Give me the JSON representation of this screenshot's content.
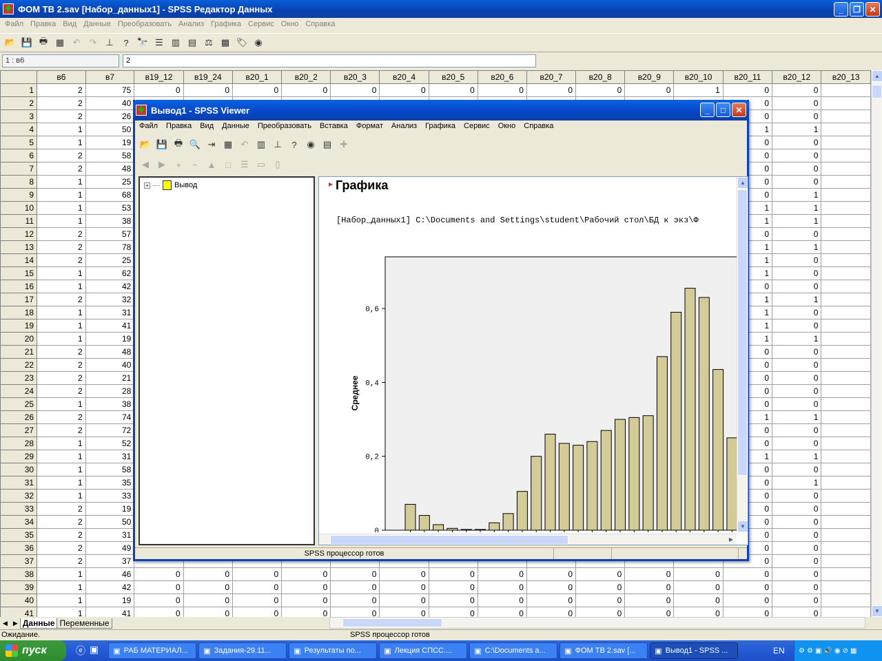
{
  "main_window": {
    "title": "ФОМ ТВ 2.sav [Набор_данных1] - SPSS Редактор Данных",
    "menu": [
      "Файл",
      "Правка",
      "Вид",
      "Данные",
      "Преобразовать",
      "Анализ",
      "Графика",
      "Сервис",
      "Окно",
      "Справка"
    ]
  },
  "cell_editor": {
    "ref": "1 : в6",
    "value": "2"
  },
  "grid": {
    "columns": [
      "в6",
      "в7",
      "в19_12",
      "в19_24",
      "в20_1",
      "в20_2",
      "в20_3",
      "в20_4",
      "в20_5",
      "в20_6",
      "в20_7",
      "в20_8",
      "в20_9",
      "в20_10",
      "в20_11",
      "в20_12",
      "в20_13"
    ],
    "rows": [
      {
        "n": "1",
        "v6": "2",
        "v7": "75",
        "r": [
          "0",
          "0",
          "0",
          "0",
          "0",
          "0",
          "0",
          "0",
          "0",
          "0",
          "0",
          "1",
          "0",
          "0"
        ]
      },
      {
        "n": "2",
        "v6": "2",
        "v7": "40",
        "r": [
          "0",
          "0",
          "0",
          "0",
          "0",
          "0",
          "0",
          "0",
          "0",
          "0",
          "0",
          "0",
          "0",
          "0"
        ]
      },
      {
        "n": "3",
        "v6": "2",
        "v7": "26",
        "r": [
          "",
          "",
          "",
          "",
          "",
          "",
          "",
          "",
          "",
          "",
          "",
          "",
          "0",
          "0"
        ]
      },
      {
        "n": "4",
        "v6": "1",
        "v7": "50",
        "r": [
          "",
          "",
          "",
          "",
          "",
          "",
          "",
          "",
          "",
          "",
          "",
          "",
          "1",
          "1"
        ]
      },
      {
        "n": "5",
        "v6": "1",
        "v7": "19",
        "r": [
          "",
          "",
          "",
          "",
          "",
          "",
          "",
          "",
          "",
          "",
          "",
          "",
          "0",
          "0"
        ]
      },
      {
        "n": "6",
        "v6": "2",
        "v7": "58",
        "r": [
          "",
          "",
          "",
          "",
          "",
          "",
          "",
          "",
          "",
          "",
          "",
          "",
          "0",
          "0"
        ]
      },
      {
        "n": "7",
        "v6": "2",
        "v7": "48",
        "r": [
          "",
          "",
          "",
          "",
          "",
          "",
          "",
          "",
          "",
          "",
          "",
          "",
          "0",
          "0"
        ]
      },
      {
        "n": "8",
        "v6": "1",
        "v7": "25",
        "r": [
          "",
          "",
          "",
          "",
          "",
          "",
          "",
          "",
          "",
          "",
          "",
          "",
          "0",
          "0"
        ]
      },
      {
        "n": "9",
        "v6": "1",
        "v7": "68",
        "r": [
          "",
          "",
          "",
          "",
          "",
          "",
          "",
          "",
          "",
          "",
          "",
          "",
          "0",
          "1"
        ]
      },
      {
        "n": "10",
        "v6": "1",
        "v7": "53",
        "r": [
          "",
          "",
          "",
          "",
          "",
          "",
          "",
          "",
          "",
          "",
          "",
          "",
          "1",
          "1"
        ]
      },
      {
        "n": "11",
        "v6": "1",
        "v7": "38",
        "r": [
          "",
          "",
          "",
          "",
          "",
          "",
          "",
          "",
          "",
          "",
          "",
          "",
          "1",
          "1"
        ]
      },
      {
        "n": "12",
        "v6": "2",
        "v7": "57",
        "r": [
          "",
          "",
          "",
          "",
          "",
          "",
          "",
          "",
          "",
          "",
          "",
          "",
          "0",
          "0"
        ]
      },
      {
        "n": "13",
        "v6": "2",
        "v7": "78",
        "r": [
          "",
          "",
          "",
          "",
          "",
          "",
          "",
          "",
          "",
          "",
          "",
          "",
          "1",
          "1"
        ]
      },
      {
        "n": "14",
        "v6": "2",
        "v7": "25",
        "r": [
          "",
          "",
          "",
          "",
          "",
          "",
          "",
          "",
          "",
          "",
          "",
          "",
          "1",
          "0"
        ]
      },
      {
        "n": "15",
        "v6": "1",
        "v7": "62",
        "r": [
          "",
          "",
          "",
          "",
          "",
          "",
          "",
          "",
          "",
          "",
          "",
          "",
          "1",
          "0"
        ]
      },
      {
        "n": "16",
        "v6": "1",
        "v7": "42",
        "r": [
          "",
          "",
          "",
          "",
          "",
          "",
          "",
          "",
          "",
          "",
          "",
          "",
          "0",
          "0"
        ]
      },
      {
        "n": "17",
        "v6": "2",
        "v7": "32",
        "r": [
          "",
          "",
          "",
          "",
          "",
          "",
          "",
          "",
          "",
          "",
          "",
          "",
          "1",
          "1"
        ]
      },
      {
        "n": "18",
        "v6": "1",
        "v7": "31",
        "r": [
          "",
          "",
          "",
          "",
          "",
          "",
          "",
          "",
          "",
          "",
          "",
          "",
          "1",
          "0"
        ]
      },
      {
        "n": "19",
        "v6": "1",
        "v7": "41",
        "r": [
          "",
          "",
          "",
          "",
          "",
          "",
          "",
          "",
          "",
          "",
          "",
          "",
          "1",
          "0"
        ]
      },
      {
        "n": "20",
        "v6": "1",
        "v7": "19",
        "r": [
          "",
          "",
          "",
          "",
          "",
          "",
          "",
          "",
          "",
          "",
          "",
          "",
          "1",
          "1"
        ]
      },
      {
        "n": "21",
        "v6": "2",
        "v7": "48",
        "r": [
          "",
          "",
          "",
          "",
          "",
          "",
          "",
          "",
          "",
          "",
          "",
          "",
          "0",
          "0"
        ]
      },
      {
        "n": "22",
        "v6": "2",
        "v7": "40",
        "r": [
          "",
          "",
          "",
          "",
          "",
          "",
          "",
          "",
          "",
          "",
          "",
          "",
          "0",
          "0"
        ]
      },
      {
        "n": "23",
        "v6": "2",
        "v7": "21",
        "r": [
          "",
          "",
          "",
          "",
          "",
          "",
          "",
          "",
          "",
          "",
          "",
          "",
          "0",
          "0"
        ]
      },
      {
        "n": "24",
        "v6": "2",
        "v7": "28",
        "r": [
          "",
          "",
          "",
          "",
          "",
          "",
          "",
          "",
          "",
          "",
          "",
          "",
          "0",
          "0"
        ]
      },
      {
        "n": "25",
        "v6": "1",
        "v7": "38",
        "r": [
          "",
          "",
          "",
          "",
          "",
          "",
          "",
          "",
          "",
          "",
          "",
          "",
          "0",
          "0"
        ]
      },
      {
        "n": "26",
        "v6": "2",
        "v7": "74",
        "r": [
          "",
          "",
          "",
          "",
          "",
          "",
          "",
          "",
          "",
          "",
          "",
          "",
          "1",
          "1"
        ]
      },
      {
        "n": "27",
        "v6": "2",
        "v7": "72",
        "r": [
          "",
          "",
          "",
          "",
          "",
          "",
          "",
          "",
          "",
          "",
          "",
          "",
          "0",
          "0"
        ]
      },
      {
        "n": "28",
        "v6": "1",
        "v7": "52",
        "r": [
          "",
          "",
          "",
          "",
          "",
          "",
          "",
          "",
          "",
          "",
          "",
          "",
          "0",
          "0"
        ]
      },
      {
        "n": "29",
        "v6": "1",
        "v7": "31",
        "r": [
          "",
          "",
          "",
          "",
          "",
          "",
          "",
          "",
          "",
          "",
          "",
          "",
          "1",
          "1"
        ]
      },
      {
        "n": "30",
        "v6": "1",
        "v7": "58",
        "r": [
          "",
          "",
          "",
          "",
          "",
          "",
          "",
          "",
          "",
          "",
          "",
          "",
          "0",
          "0"
        ]
      },
      {
        "n": "31",
        "v6": "1",
        "v7": "35",
        "r": [
          "",
          "",
          "",
          "",
          "",
          "",
          "",
          "",
          "",
          "",
          "",
          "",
          "0",
          "1"
        ]
      },
      {
        "n": "32",
        "v6": "1",
        "v7": "33",
        "r": [
          "",
          "",
          "",
          "",
          "",
          "",
          "",
          "",
          "",
          "",
          "",
          "",
          "0",
          "0"
        ]
      },
      {
        "n": "33",
        "v6": "2",
        "v7": "19",
        "r": [
          "",
          "",
          "",
          "",
          "",
          "",
          "",
          "",
          "",
          "",
          "",
          "",
          "0",
          "0"
        ]
      },
      {
        "n": "34",
        "v6": "2",
        "v7": "50",
        "r": [
          "",
          "",
          "",
          "",
          "",
          "",
          "",
          "",
          "",
          "",
          "",
          "",
          "0",
          "0"
        ]
      },
      {
        "n": "35",
        "v6": "2",
        "v7": "31",
        "r": [
          "",
          "",
          "",
          "",
          "",
          "",
          "",
          "",
          "",
          "",
          "",
          "",
          "0",
          "0"
        ]
      },
      {
        "n": "36",
        "v6": "2",
        "v7": "49",
        "r": [
          "",
          "",
          "",
          "",
          "",
          "",
          "",
          "",
          "",
          "",
          "",
          "",
          "0",
          "0"
        ]
      },
      {
        "n": "37",
        "v6": "2",
        "v7": "37",
        "r": [
          "",
          "",
          "",
          "",
          "",
          "",
          "",
          "",
          "",
          "",
          "",
          "",
          "0",
          "0"
        ]
      },
      {
        "n": "38",
        "v6": "1",
        "v7": "46",
        "r": [
          "0",
          "0",
          "0",
          "0",
          "0",
          "0",
          "0",
          "0",
          "0",
          "0",
          "0",
          "0",
          "0",
          "0"
        ]
      },
      {
        "n": "39",
        "v6": "1",
        "v7": "42",
        "r": [
          "0",
          "0",
          "0",
          "0",
          "0",
          "0",
          "0",
          "0",
          "0",
          "0",
          "0",
          "0",
          "0",
          "0"
        ]
      },
      {
        "n": "40",
        "v6": "1",
        "v7": "19",
        "r": [
          "0",
          "0",
          "0",
          "0",
          "0",
          "0",
          "0",
          "0",
          "0",
          "0",
          "0",
          "0",
          "0",
          "0"
        ]
      },
      {
        "n": "41",
        "v6": "1",
        "v7": "41",
        "r": [
          "0",
          "0",
          "0",
          "0",
          "0",
          "0",
          "0",
          "0",
          "0",
          "0",
          "0",
          "0",
          "0",
          "0"
        ]
      }
    ]
  },
  "sheet_tabs": [
    "Данные",
    "Переменные"
  ],
  "status": {
    "left": "Ожидание.",
    "center": "SPSS процессор готов"
  },
  "viewer": {
    "title": "Вывод1 - SPSS Viewer",
    "menu": [
      "Файл",
      "Правка",
      "Вид",
      "Данные",
      "Преобразовать",
      "Вставка",
      "Формат",
      "Анализ",
      "Графика",
      "Сервис",
      "Окно",
      "Справка"
    ],
    "outline_root": "Вывод",
    "heading": "Графика",
    "dataset_line": "[Набор_данных1] C:\\Documents and Settings\\student\\Рабочий стол\\БД к экз\\Ф",
    "status": "SPSS процессор готов"
  },
  "chart_data": {
    "type": "bar",
    "ylabel": "Среднее",
    "yticks": [
      "0",
      "0,2",
      "0,4",
      "0,6"
    ],
    "ylim": [
      0,
      0.74
    ],
    "values": [
      0.07,
      0.04,
      0.015,
      0.005,
      0.002,
      0.002,
      0.02,
      0.045,
      0.105,
      0.2,
      0.26,
      0.235,
      0.23,
      0.24,
      0.27,
      0.3,
      0.305,
      0.31,
      0.47,
      0.59,
      0.655,
      0.63,
      0.435,
      0.25
    ],
    "bar_color": "#d4cc98",
    "plot_bg": "#f0f0f0"
  },
  "taskbar": {
    "start": "пуск",
    "tasks": [
      "РАБ МАТЕРИАЛ...",
      "Задания-29.11...",
      "Результаты по...",
      "Лекция СПСС....",
      "C:\\Documents a...",
      "ФОМ ТВ 2.sav [...",
      "Вывод1 - SPSS ..."
    ],
    "lang": "EN"
  }
}
